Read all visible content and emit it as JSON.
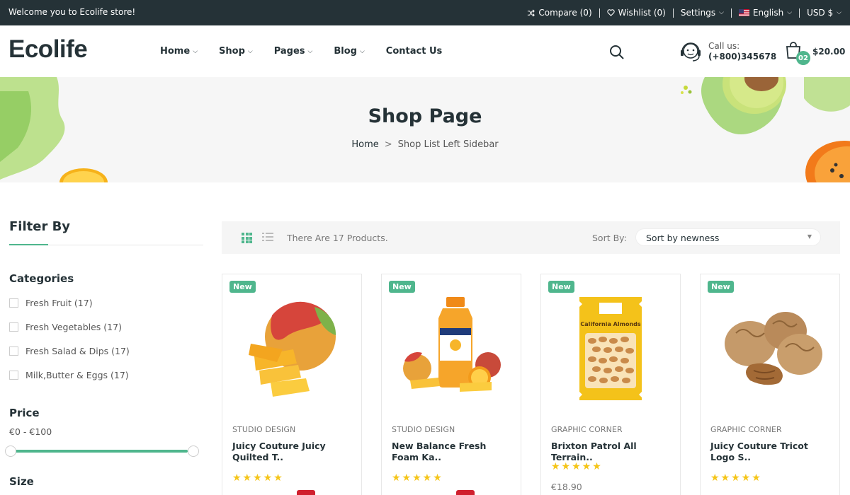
{
  "topbar": {
    "welcome": "Welcome you to Ecolife store!",
    "compare": "Compare (0)",
    "wishlist": "Wishlist (0)",
    "settings": "Settings",
    "language": "English",
    "currency": "USD $"
  },
  "header": {
    "logo": "Ecolife",
    "nav": [
      {
        "label": "Home",
        "has_caret": true
      },
      {
        "label": "Shop",
        "has_caret": true
      },
      {
        "label": "Pages",
        "has_caret": true
      },
      {
        "label": "Blog",
        "has_caret": true
      },
      {
        "label": "Contact Us",
        "has_caret": false
      }
    ],
    "call_label": "Call us:",
    "call_number": "(+800)345678",
    "cart_count": "02",
    "cart_total": "$20.00"
  },
  "hero": {
    "title": "Shop Page",
    "breadcrumb_home": "Home",
    "breadcrumb_sep": ">",
    "breadcrumb_current": "Shop List Left Sidebar"
  },
  "sidebar": {
    "filter_title": "Filter By",
    "categories_title": "Categories",
    "categories": [
      "Fresh Fruit (17)",
      "Fresh Vegetables  (17)",
      "Fresh Salad & Dips (17)",
      "Milk,Butter & Eggs (17)"
    ],
    "price_title": "Price",
    "price_range": "€0 - €100",
    "size_title": "Size"
  },
  "toolbar": {
    "count_text": "There Are 17 Products.",
    "sort_label": "Sort By:",
    "sort_value": "Sort by newness"
  },
  "products": [
    {
      "badge": "New",
      "vendor": "STUDIO DESIGN",
      "name": "Juicy Couture Juicy Quilted T..",
      "rating": 5,
      "image": "mango-image"
    },
    {
      "badge": "New",
      "vendor": "STUDIO DESIGN",
      "name": "New Balance Fresh Foam Ka..",
      "rating": 5,
      "image": "juice-bottle-image"
    },
    {
      "badge": "New",
      "vendor": "GRAPHIC CORNER",
      "name": "Brixton Patrol All Terrain..",
      "rating": 5,
      "price": "€18.90",
      "image": "almond-bag-image"
    },
    {
      "badge": "New",
      "vendor": "GRAPHIC CORNER",
      "name": "Juicy Couture Tricot Logo S..",
      "rating": 5,
      "image": "walnut-image"
    }
  ],
  "almond_bag_label": "California Almonds",
  "colors": {
    "accent": "#4fb68d",
    "dark": "#253237",
    "star": "#f5c518",
    "sale": "#d0202e"
  }
}
